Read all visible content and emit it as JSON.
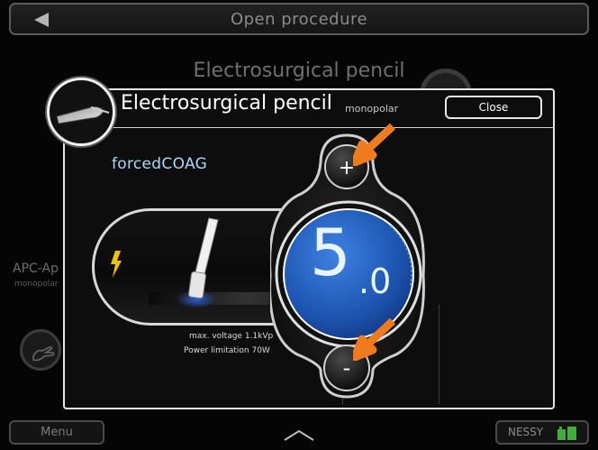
{
  "topbar": {
    "title": "Open procedure",
    "back_icon": "back-arrow-icon"
  },
  "background": {
    "heading": "Electrosurgical pencil",
    "apc_label": "APC-Ap",
    "apc_sub": "monopolar"
  },
  "modal": {
    "title": "Electrosurgical pencil",
    "subtitle": "monopolar",
    "close_label": "Close",
    "mode": "forcedCOAG",
    "value_int": "5",
    "value_dec": ".0",
    "info_voltage": "max. voltage 1.1kVp",
    "info_power": "Power limitation 70W",
    "plus_label": "+",
    "minus_label": "-"
  },
  "bottombar": {
    "menu_label": "Menu",
    "nessy_label": "NESSY"
  },
  "colors": {
    "accent_blue": "#1f5bb5",
    "mode_text": "#a9d8f5",
    "arrow_orange": "#f07a1e"
  }
}
